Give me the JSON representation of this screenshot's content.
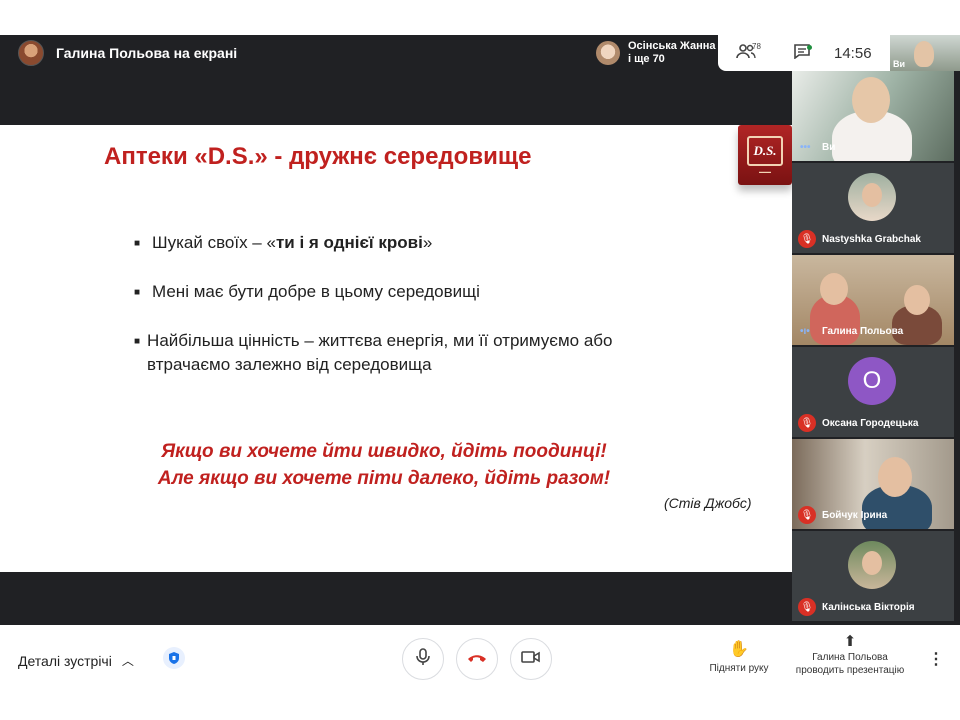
{
  "presenter": {
    "name": "Галина Польова на екрані"
  },
  "others": {
    "line1": "Осінська Жанна",
    "line2": "і ще 70"
  },
  "top_icons": {
    "people_count": "78",
    "people_icon": "people-icon",
    "chat_icon": "chat-icon"
  },
  "clock": "14:56",
  "self_view": {
    "label": "Ви"
  },
  "slide": {
    "title": "Аптеки «D.S.»  - дружнє середовище",
    "logo_text": "D.S.",
    "bullets": [
      {
        "text": "Шукай своїх – «",
        "bold": "ти і я однієї крові",
        "end": "»"
      },
      {
        "text": "Мені має бути добре в цьому середовищі"
      },
      {
        "text": "Найбільша цінність – життєва енергія, ми її отримуємо або втрачаємо залежно від середовища"
      }
    ],
    "quote_line1": "Якщо ви хочете йти швидко, йдіть поодинці!",
    "quote_line2": "Але якщо ви хочете піти далеко, йдіть разом!",
    "author": "(Стів Джобс)"
  },
  "participants": [
    {
      "name": "Ви",
      "type": "video",
      "muted": false
    },
    {
      "name": "Nastyshka Grabchak",
      "type": "photo",
      "muted": true
    },
    {
      "name": "Галина Польова",
      "type": "video",
      "muted": false
    },
    {
      "name": "Оксана Городецька",
      "type": "initial",
      "initial": "О",
      "muted": true
    },
    {
      "name": "Бойчук Ірина",
      "type": "video",
      "muted": true
    },
    {
      "name": "Калінська Вікторія",
      "type": "photo",
      "muted": true
    }
  ],
  "bottom": {
    "details_label": "Деталі зустрічі",
    "raise_hand": "Підняти руку",
    "presenting_line1": "Галина Польова",
    "presenting_line2": "проводить презентацію"
  },
  "colors": {
    "accent_red": "#c0211f",
    "mute_red": "#d93025",
    "avatar_purple": "#8e57c5"
  }
}
